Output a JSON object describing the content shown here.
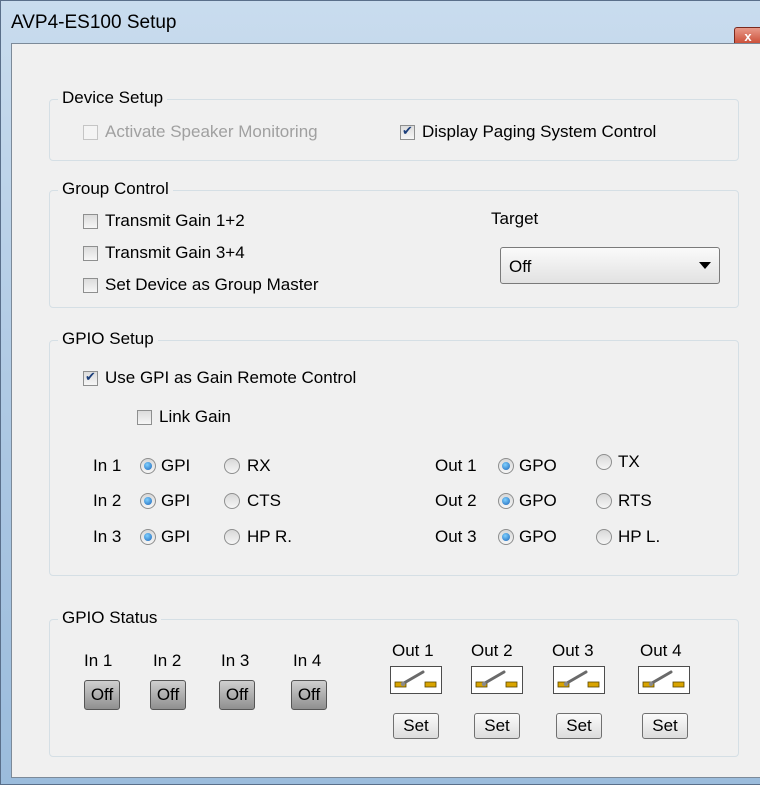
{
  "window": {
    "title": "AVP4-ES100 Setup",
    "close_glyph": "x"
  },
  "device_setup": {
    "legend": "Device Setup",
    "activate_speaker_monitoring": {
      "label": "Activate Speaker Monitoring",
      "checked": false,
      "enabled": false
    },
    "display_paging_system_control": {
      "label": "Display Paging System Control",
      "checked": true,
      "enabled": true
    }
  },
  "group_control": {
    "legend": "Group Control",
    "transmit_gain_12": {
      "label": "Transmit Gain 1+2",
      "checked": false
    },
    "transmit_gain_34": {
      "label": "Transmit Gain 3+4",
      "checked": false
    },
    "set_group_master": {
      "label": "Set Device as Group Master",
      "checked": false
    },
    "target_label": "Target",
    "target_value": "Off"
  },
  "gpio_setup": {
    "legend": "GPIO Setup",
    "use_gpi_gain": {
      "label": "Use GPI as Gain Remote Control",
      "checked": true
    },
    "link_gain": {
      "label": "Link Gain",
      "checked": false
    },
    "inputs": [
      {
        "label": "In 1",
        "opt_a": "GPI",
        "opt_b": "RX",
        "selected": "a"
      },
      {
        "label": "In 2",
        "opt_a": "GPI",
        "opt_b": "CTS",
        "selected": "a"
      },
      {
        "label": "In 3",
        "opt_a": "GPI",
        "opt_b": "HP R.",
        "selected": "a"
      }
    ],
    "outputs": [
      {
        "label": "Out 1",
        "opt_a": "GPO",
        "opt_b": "TX",
        "selected": "a"
      },
      {
        "label": "Out 2",
        "opt_a": "GPO",
        "opt_b": "RTS",
        "selected": "a"
      },
      {
        "label": "Out 3",
        "opt_a": "GPO",
        "opt_b": "HP L.",
        "selected": "a"
      }
    ]
  },
  "gpio_status": {
    "legend": "GPIO Status",
    "inputs": [
      {
        "label": "In 1",
        "state": "Off"
      },
      {
        "label": "In 2",
        "state": "Off"
      },
      {
        "label": "In 3",
        "state": "Off"
      },
      {
        "label": "In 4",
        "state": "Off"
      }
    ],
    "outputs": [
      {
        "label": "Out 1",
        "button": "Set",
        "icon": "relay-switch-icon"
      },
      {
        "label": "Out 2",
        "button": "Set",
        "icon": "relay-switch-icon"
      },
      {
        "label": "Out 3",
        "button": "Set",
        "icon": "relay-switch-icon"
      },
      {
        "label": "Out 4",
        "button": "Set",
        "icon": "relay-switch-icon"
      }
    ]
  },
  "colors": {
    "accent": "#1a64b8",
    "frame": "#aac6e2",
    "client": "#f0f0f0"
  }
}
